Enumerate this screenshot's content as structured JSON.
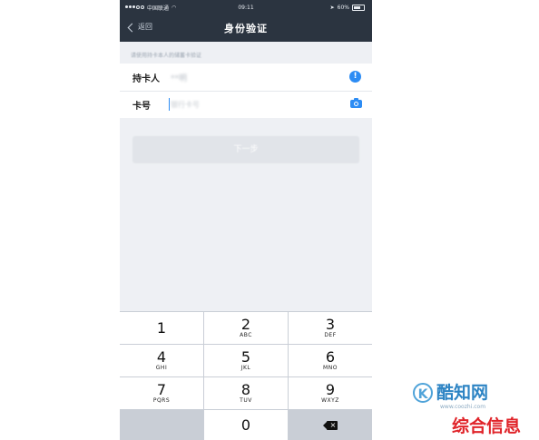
{
  "statusbar": {
    "carrier": "中国联通",
    "time": "09:11",
    "battery": "60%"
  },
  "navbar": {
    "back_label": "返回",
    "title": "身份验证"
  },
  "hint": "请使用持卡本人的储蓄卡验证",
  "form": {
    "holder_label": "持卡人",
    "holder_value": "**明",
    "card_label": "卡号",
    "card_placeholder": "银行卡号"
  },
  "next_button": "下一步",
  "keypad": [
    {
      "num": "1",
      "letters": ""
    },
    {
      "num": "2",
      "letters": "ABC"
    },
    {
      "num": "3",
      "letters": "DEF"
    },
    {
      "num": "4",
      "letters": "GHI"
    },
    {
      "num": "5",
      "letters": "JKL"
    },
    {
      "num": "6",
      "letters": "MNO"
    },
    {
      "num": "7",
      "letters": "PQRS"
    },
    {
      "num": "8",
      "letters": "TUV"
    },
    {
      "num": "9",
      "letters": "WXYZ"
    },
    {
      "num": "0",
      "letters": ""
    }
  ],
  "watermark": {
    "logo_text": "酷知网",
    "url": "www.coozhi.com",
    "subtitle": "综合信息"
  },
  "colors": {
    "accent": "#2c8cf4",
    "navbar": "#2b3440",
    "background": "#eef0f4"
  }
}
